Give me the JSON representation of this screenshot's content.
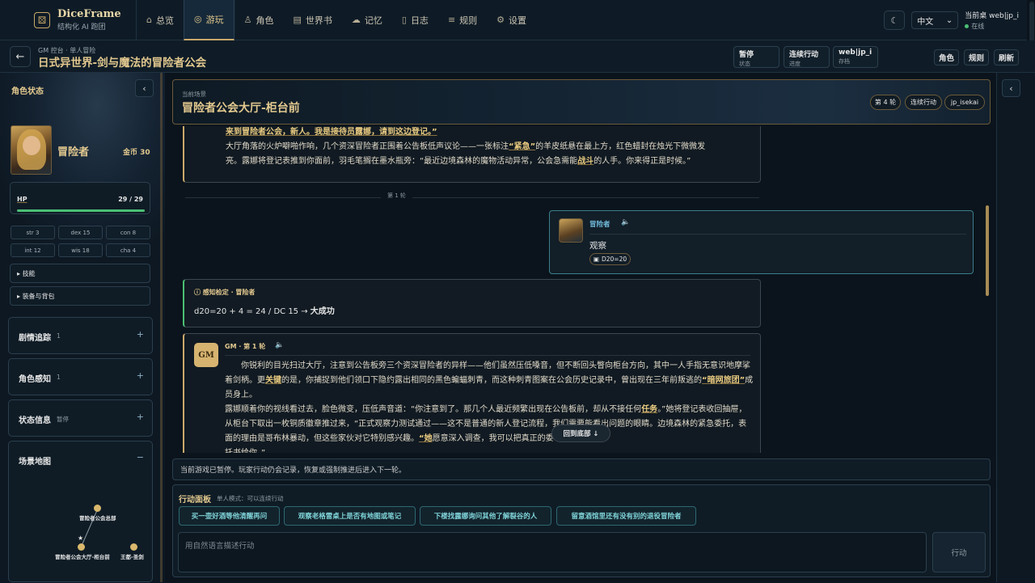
{
  "app": {
    "name": "DiceFrame",
    "subtitle": "结构化 AI 跑团"
  },
  "nav": [
    {
      "label": "总览",
      "icon": "home-icon",
      "glyph": "⌂"
    },
    {
      "label": "游玩",
      "icon": "gamepad-icon",
      "glyph": "◎"
    },
    {
      "label": "角色",
      "icon": "user-icon",
      "glyph": "♙"
    },
    {
      "label": "世界书",
      "icon": "book-icon",
      "glyph": "▤"
    },
    {
      "label": "记忆",
      "icon": "cloud-icon",
      "glyph": "☁"
    },
    {
      "label": "日志",
      "icon": "document-icon",
      "glyph": "▯"
    },
    {
      "label": "规则",
      "icon": "sliders-icon",
      "glyph": "≡"
    },
    {
      "label": "设置",
      "icon": "gear-icon",
      "glyph": "⚙"
    }
  ],
  "topbar": {
    "language": "中文",
    "user_label": "当前桌 web|jp_i",
    "status": "在线"
  },
  "header": {
    "breadcrumb": "GM 控台 · 单人冒险",
    "title": "日式异世界-剑与魔法的冒险者公会",
    "stats": [
      {
        "value": "暂停",
        "label": "状态"
      },
      {
        "value": "连续行动",
        "label": "进度"
      },
      {
        "value": "web|jp_i",
        "label": "存档"
      }
    ],
    "buttons": [
      "角色",
      "规则",
      "刷新"
    ]
  },
  "sidebar": {
    "title": "角色状态",
    "character": {
      "name": "冒险者",
      "gold": "金币 30"
    },
    "hp": {
      "label": "HP",
      "value": "29 / 29",
      "fraction": 1.0
    },
    "stats": [
      "str 3",
      "dex 15",
      "con 8",
      "int 12",
      "wis 18",
      "cha 4"
    ],
    "folds": [
      "技能",
      "装备与背包"
    ],
    "sections": [
      {
        "title": "剧情追踪",
        "count": "1"
      },
      {
        "title": "角色感知",
        "count": "1"
      },
      {
        "title": "状态信息",
        "count": "暂停"
      }
    ],
    "map": {
      "title": "场景地图",
      "nodes": [
        "冒险者公会总部",
        "冒险者公会大厅-柜台前",
        "王都-圣剑"
      ]
    }
  },
  "scene": {
    "label": "当前场景",
    "title": "冒险者公会大厅-柜台前",
    "pills": [
      "第 4 轮",
      "连续行动",
      "jp_isekai"
    ]
  },
  "chat": {
    "intro": {
      "line1": "来到冒险者公会，新人。我是接待员露娜，请到这边登记。”",
      "p_a": "大厅角落的火炉噼啪作响，几个资深冒险者正围着公告板低声议论——一张标注",
      "p_hl1": "“紧急”",
      "p_b": "的羊皮纸悬在最上方，红色蜡封在烛光下微微发亮。露娜将登记表推到你面前，羽毛笔搁在墨水瓶旁：“最近边境森林的魔物活动异常，公会急需能",
      "p_hl2": "战斗",
      "p_c": "的人手。你来得正是时候。”"
    },
    "round_divider": "第 1 轮",
    "player": {
      "name": "冒险者",
      "action": "观察",
      "dice": "D20=20"
    },
    "check": {
      "title": "感知检定 · 冒险者",
      "formula": "d20=20 + 4 = 24 / DC 15 → ",
      "result": "大成功"
    },
    "gm": {
      "avatar": "GM",
      "title": "GM · 第 1 轮",
      "p1_a": "你锐利的目光扫过大厅，注意到公告板旁三个资深冒险者的异样——他们虽然压低嗓音，但不断回头瞥向柜台方向，其中一人手指无意识地摩挲着剑柄。更",
      "p1_hl1": "关键",
      "p1_b": "的是，你捕捉到他们领口下隐约露出相同的黑色蝙蝠刺青，而这种刺青图案在公会历史记录中，曾出现在三年前叛逃的",
      "p1_hl2": "“暗网旅团”",
      "p1_c": "成员身上。",
      "p2_a": "露娜顺着你的视线看过去，脸色微变，压低声音道：“你注意到了。那几个人最近频繁出现在公告板前，却从不接任何",
      "p2_hl1": "任务",
      "p2_b": "。”她将登记表收回抽屉，从柜台下取出一枚铜质徽章推过来，“正式观察力测试通过——这不是普通的新人登记流程，我们需要能看出问题的眼睛。边境森林的紧急委托，表面的理由是哥布林暴动，但这些家伙对它特别感兴趣。",
      "p2_hl2": "“她",
      "p2_c": "愿意深入调查，我可以把真正的委",
      "p3": "托书给你。”"
    },
    "to_bottom": "回到底部 ↓"
  },
  "paused_notice": "当前游戏已暂停。玩家行动仍会记录，恢复或强制推进后进入下一轮。",
  "action_panel": {
    "title": "行动面板",
    "mode": "单人模式：可以连续行动",
    "suggestions": [
      "买一壶好酒等他清醒再问",
      "观察老格雷桌上是否有地图或笔记",
      "下楼找露娜询问其他了解裂谷的人",
      "留意酒馆里还有没有别的退役冒险者"
    ],
    "placeholder": "用自然语言描述行动",
    "send": "行动"
  },
  "colors": {
    "accent": "#e3c98f",
    "teal": "#7fd3d8",
    "success": "#4bbf74"
  }
}
